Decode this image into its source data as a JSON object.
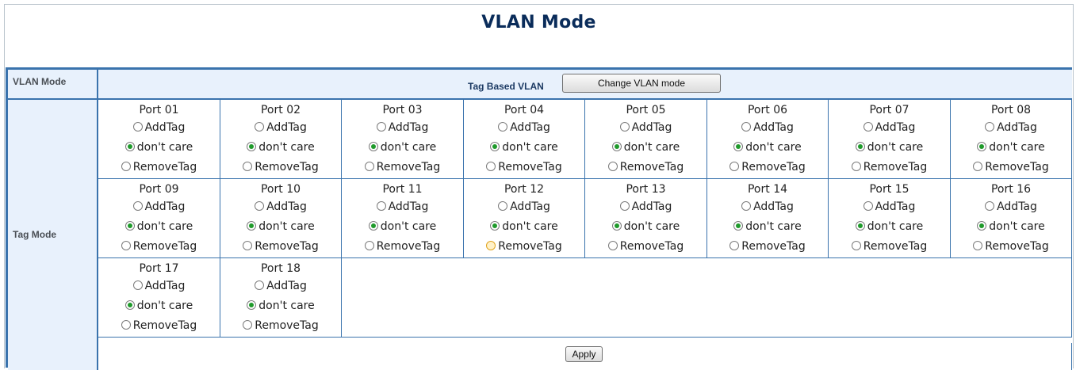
{
  "page_title": "VLAN Mode",
  "vlan_mode": {
    "label": "VLAN Mode",
    "current_mode": "Tag Based VLAN",
    "change_button": "Change VLAN mode"
  },
  "tag_mode": {
    "label": "Tag Mode",
    "option_labels": {
      "add": "AddTag",
      "dontcare": "don't care",
      "remove": "RemoveTag"
    },
    "ports": [
      {
        "name": "Port 01",
        "selected": "dontcare"
      },
      {
        "name": "Port 02",
        "selected": "dontcare"
      },
      {
        "name": "Port 03",
        "selected": "dontcare"
      },
      {
        "name": "Port 04",
        "selected": "dontcare"
      },
      {
        "name": "Port 05",
        "selected": "dontcare"
      },
      {
        "name": "Port 06",
        "selected": "dontcare"
      },
      {
        "name": "Port 07",
        "selected": "dontcare"
      },
      {
        "name": "Port 08",
        "selected": "dontcare"
      },
      {
        "name": "Port 09",
        "selected": "dontcare"
      },
      {
        "name": "Port 10",
        "selected": "dontcare"
      },
      {
        "name": "Port 11",
        "selected": "dontcare"
      },
      {
        "name": "Port 12",
        "selected": "dontcare",
        "hover": "remove"
      },
      {
        "name": "Port 13",
        "selected": "dontcare"
      },
      {
        "name": "Port 14",
        "selected": "dontcare"
      },
      {
        "name": "Port 15",
        "selected": "dontcare"
      },
      {
        "name": "Port 16",
        "selected": "dontcare"
      },
      {
        "name": "Port 17",
        "selected": "dontcare"
      },
      {
        "name": "Port 18",
        "selected": "dontcare"
      }
    ]
  },
  "apply_button": "Apply",
  "colors": {
    "title": "#0a2c5a",
    "border": "#3a73ad",
    "label_bg": "#e8f1fc",
    "radio_checked": "#1f9a2b",
    "radio_hover": "#e0a31d"
  }
}
